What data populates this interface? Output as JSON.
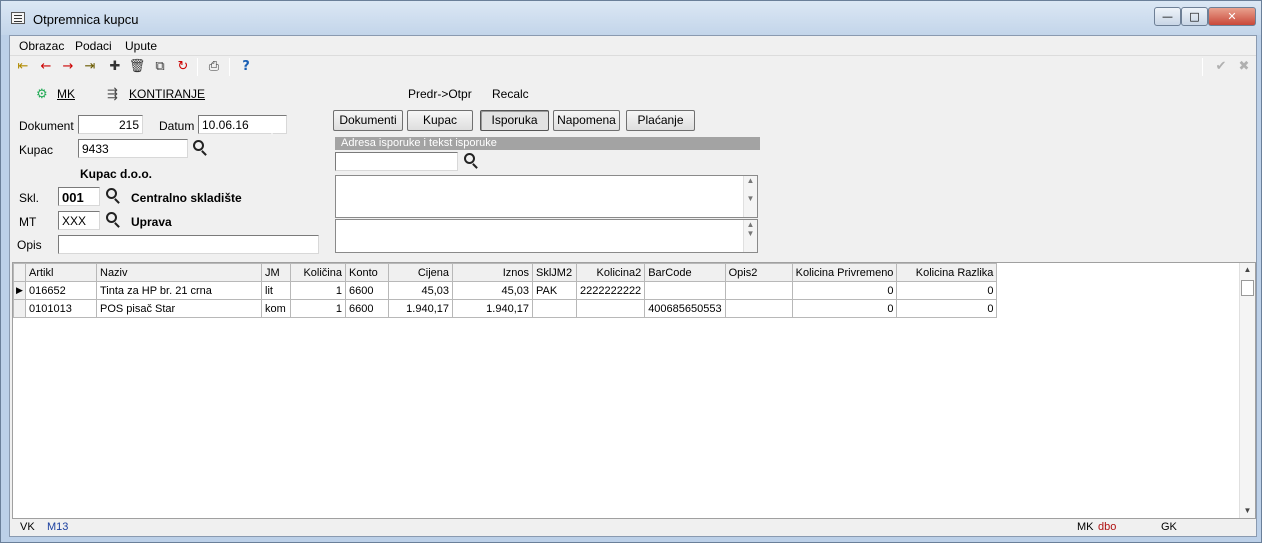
{
  "window": {
    "title": "Otpremnica kupcu",
    "minimize_glyph": "—",
    "maximize_glyph": "□",
    "close_glyph": "✕"
  },
  "menu": [
    "Obrazac",
    "Podaci",
    "Upute"
  ],
  "toolbar": {
    "icons": [
      "first-record-icon",
      "previous-record-icon",
      "next-record-icon",
      "last-record-icon",
      "new-record-icon",
      "delete-icon",
      "copy-icon",
      "refresh-icon",
      "print-icon",
      "help-icon"
    ],
    "help_label": "?",
    "confirm_glyph": "✔",
    "cancel_glyph": "✖"
  },
  "actions": {
    "mk": "MK",
    "kontiranje": "KONTIRANJE",
    "predr_otpr": "Predr->Otpr",
    "recalc": "Recalc"
  },
  "form": {
    "dokument_label": "Dokument",
    "dokument_value": "215",
    "datum_label": "Datum",
    "datum_value": "10.06.16",
    "kupac_label": "Kupac",
    "kupac_value": "9433",
    "kupac_name": "Kupac d.o.o.",
    "skl_label": "Skl.",
    "skl_value": "001",
    "skl_name": "Centralno skladište",
    "mt_label": "MT",
    "mt_value": "XXX",
    "mt_name": "Uprava",
    "opis_label": "Opis",
    "opis_value": ""
  },
  "tabs": [
    {
      "label": "Dokumenti",
      "active": false
    },
    {
      "label": "Kupac",
      "active": false
    },
    {
      "label": "Isporuka",
      "active": true
    },
    {
      "label": "Napomena",
      "active": false
    },
    {
      "label": "Plaćanje",
      "active": false
    }
  ],
  "delivery_panel": {
    "caption": "Adresa isporuke i tekst isporuke",
    "address_value": ""
  },
  "grid": {
    "columns": [
      "Artikl",
      "Naziv",
      "JM",
      "Količina",
      "Konto",
      "Cijena",
      "Iznos",
      "SklJM2",
      "Kolicina2",
      "BarCode",
      "Opis2",
      "Kolicina Privremeno",
      "Kolicina Razlika"
    ],
    "rows": [
      [
        "016652",
        "Tinta za HP br. 21 crna",
        "lit",
        "1",
        "6600",
        "45,03",
        "45,03",
        "PAK",
        "2222222222",
        "",
        "",
        "0",
        "0"
      ],
      [
        "0101013",
        "POS pisač Star",
        "kom",
        "1",
        "6600",
        "1.940,17",
        "1.940,17",
        "",
        "",
        "400685650553",
        "",
        "0",
        "0"
      ]
    ]
  },
  "status": {
    "vk_label": "VK",
    "vk_value": "M13",
    "mk_label": "MK",
    "mk_value": "dbo",
    "gk_label": "GK"
  },
  "colors": {
    "status_blue": "#1a3fa0",
    "status_red": "#b01010"
  }
}
